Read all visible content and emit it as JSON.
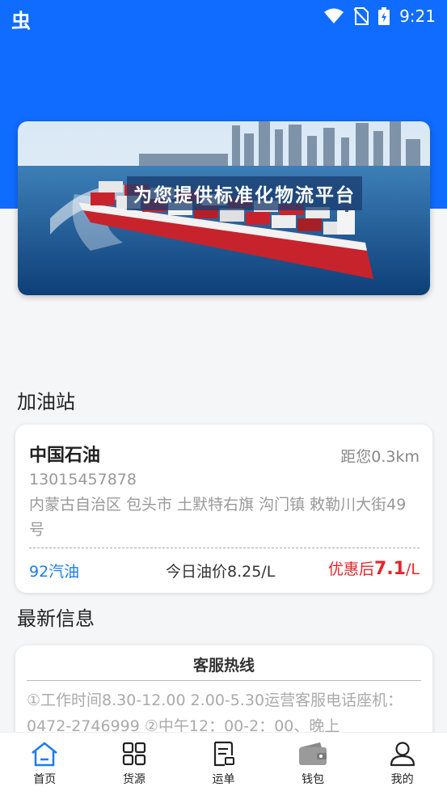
{
  "status_bar": {
    "left_icon": "app-notification-icon",
    "left_glyph": "虫",
    "time": "9:21",
    "icons": [
      "wifi-icon",
      "no-sim-icon",
      "battery-charging-icon"
    ]
  },
  "banner": {
    "caption": "为您提供标准化物流平台"
  },
  "gas_section": {
    "title": "加油站"
  },
  "station": {
    "name": "中国石油",
    "distance": "距您0.3km",
    "phone": "13015457878",
    "address": "内蒙古自治区 包头市 土默特右旗 沟门镇 敕勒川大街49号",
    "fuel_type": "92汽油",
    "today_price": "今日油价8.25/L",
    "discount_prefix": "优惠后",
    "discount_value": "7.1",
    "discount_suffix": "/L"
  },
  "news_section": {
    "title": "最新信息"
  },
  "info_card": {
    "title": "客服热线",
    "text": "①工作时间8.30-12.00 2.00-5.30运营客服电话座机：0472-2746999 ②中午12：00-2：00、晚上"
  },
  "tab_bar": {
    "active_color": "#1a7cf0",
    "tabs": [
      {
        "label": "首页",
        "icon": "home-icon"
      },
      {
        "label": "货源",
        "icon": "grid-icon"
      },
      {
        "label": "运单",
        "icon": "waybill-icon"
      },
      {
        "label": "钱包",
        "icon": "wallet-icon"
      },
      {
        "label": "我的",
        "icon": "profile-icon"
      }
    ]
  }
}
